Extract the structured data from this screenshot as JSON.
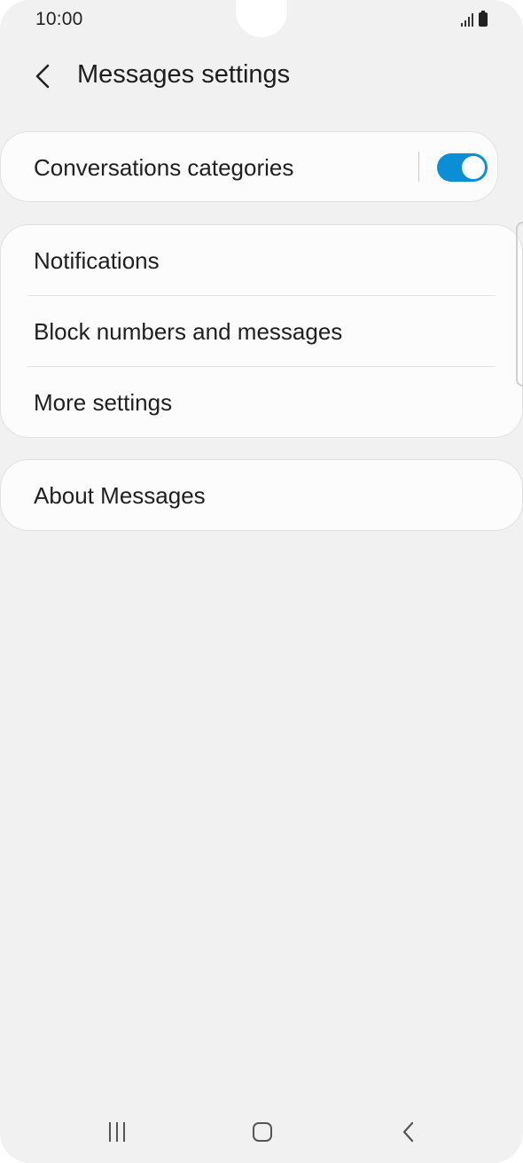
{
  "status_bar": {
    "time": "10:00"
  },
  "header": {
    "title": "Messages settings",
    "back_icon": "chevron-left-icon"
  },
  "conversations_card": {
    "label": "Conversations categories",
    "toggle_on": true,
    "toggle_color": "#0A8FD6"
  },
  "settings_card": {
    "items": [
      {
        "label": "Notifications"
      },
      {
        "label": "Block numbers and messages"
      },
      {
        "label": "More settings"
      }
    ]
  },
  "about_card": {
    "label": "About Messages"
  },
  "nav_bar": {
    "recent_icon": "recent-apps-icon",
    "home_icon": "home-icon",
    "back_icon": "back-icon"
  }
}
